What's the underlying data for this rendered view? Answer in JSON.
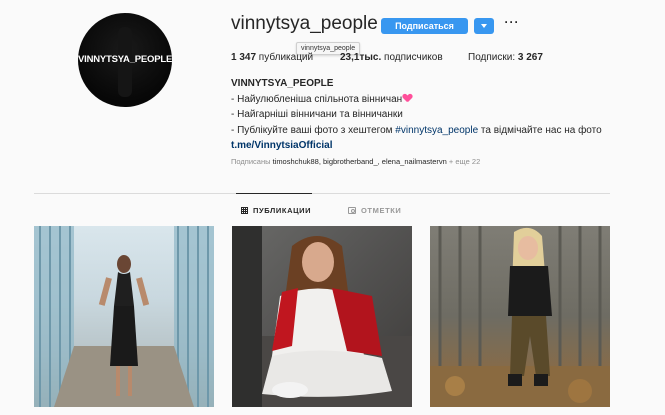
{
  "profile": {
    "username": "vinnytsya_people",
    "avatar_text": "VINNYTSYA_PEOPLE",
    "follow_label": "Подписаться",
    "more_label": "···",
    "tooltip": "vinnytsya_people"
  },
  "stats": {
    "posts_count": "1 347",
    "posts_label": " публикаций",
    "followers_count": "23,1тыс.",
    "followers_label": " подписчиков",
    "following_label": "Подписки: ",
    "following_count": "3 267"
  },
  "bio": {
    "title": "VINNYTSYA_PEOPLE",
    "line1": "- Найулюбленіша спільнота вінничан",
    "line2": "- Найгарніші вінничани та вінничанки",
    "line3_prefix": "- Публікуйте ваші фото з хештегом ",
    "line3_tag": "#vinnytsya_people",
    "line3_suffix": " та відмічайте нас на фото",
    "link": "t.me/VinnytsiaOfficial"
  },
  "followed_by": {
    "prefix": "Подписаны ",
    "accounts": "timoshchuk88, bigbrotherband_, elena_nailmastervn",
    "suffix": " + еще 22"
  },
  "tabs": [
    {
      "label": "ПУБЛИКАЦИИ",
      "icon": "grid-icon",
      "active": true
    },
    {
      "label": "ОТМЕТКИ",
      "icon": "tag-icon",
      "active": false
    }
  ],
  "colors": {
    "accent": "#3897f0",
    "link": "#003569",
    "heart": "#ff4f9a"
  }
}
